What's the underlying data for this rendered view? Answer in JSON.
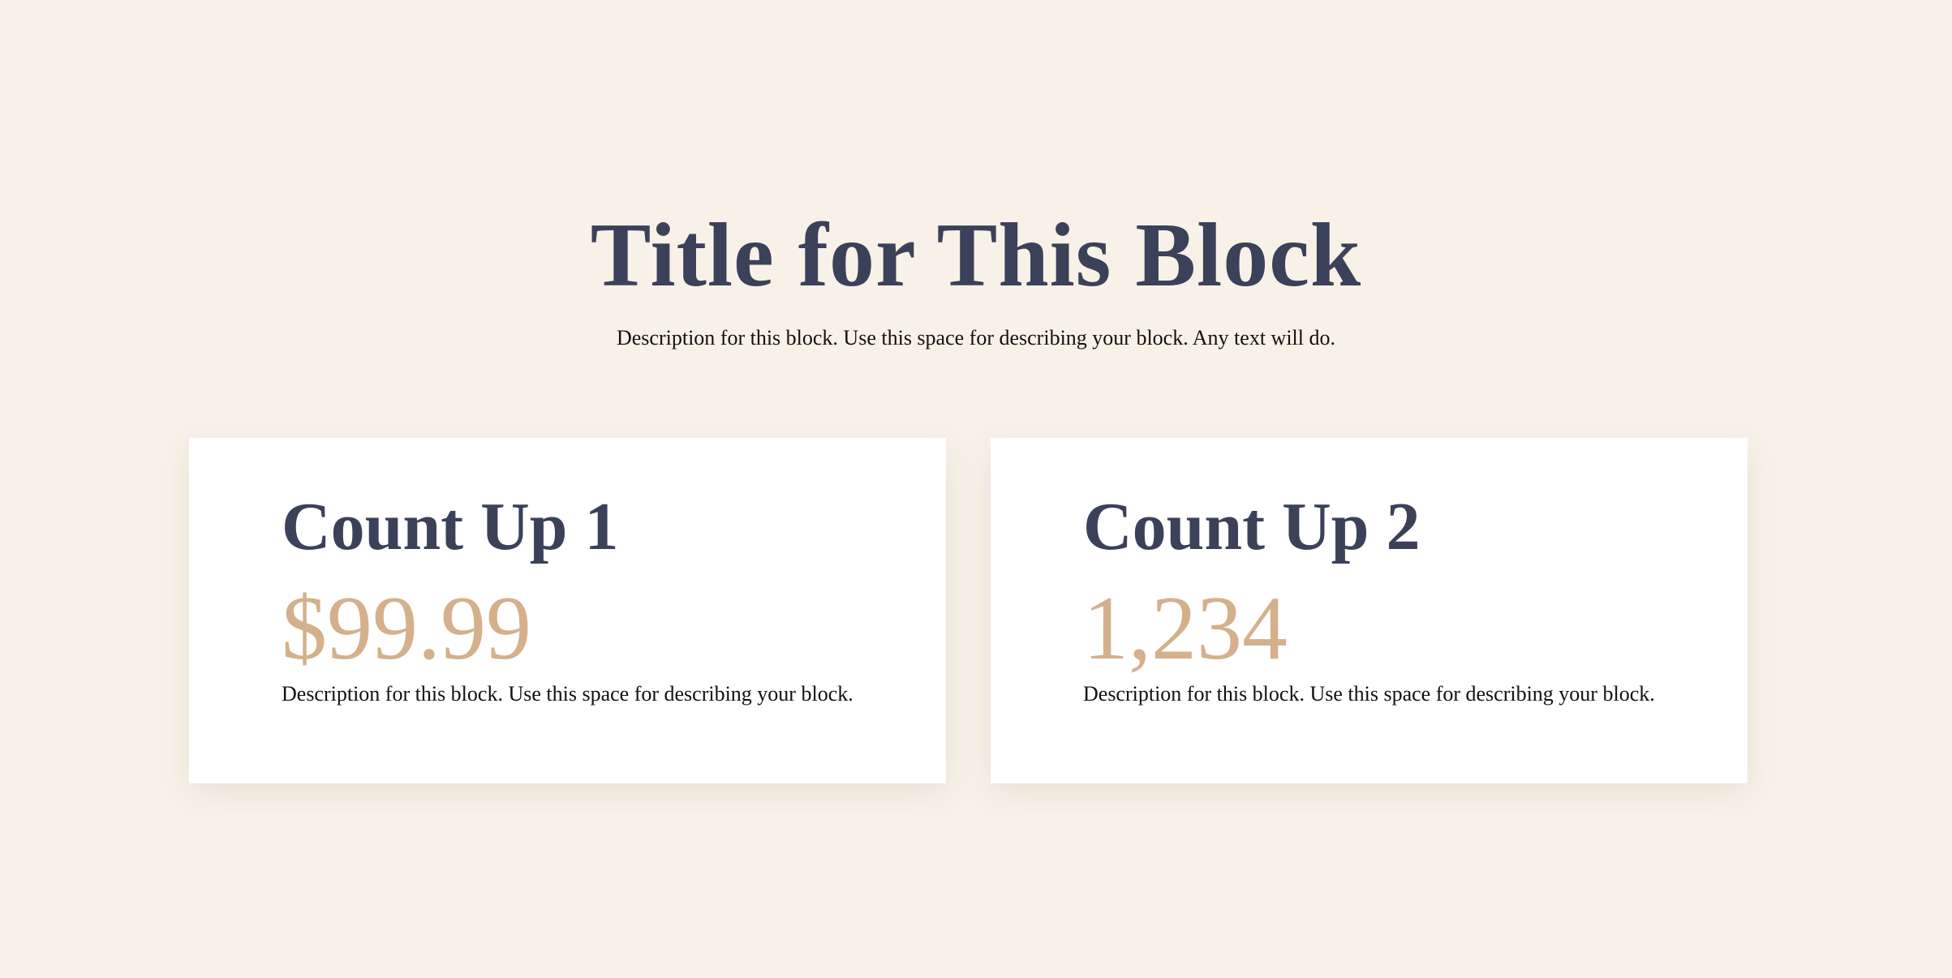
{
  "header": {
    "title": "Title for This Block",
    "description": "Description for this block. Use this space for describing your block. Any text will do."
  },
  "cards": [
    {
      "title": "Count Up 1",
      "value": "$99.99",
      "description": "Description for this block. Use this space for describing your block."
    },
    {
      "title": "Count Up 2",
      "value": "1,234",
      "description": "Description for this block. Use this space for describing your block."
    }
  ],
  "colors": {
    "background": "#f8f1e8",
    "heading": "#3b4159",
    "accent": "#d4b08c",
    "card": "#ffffff"
  }
}
